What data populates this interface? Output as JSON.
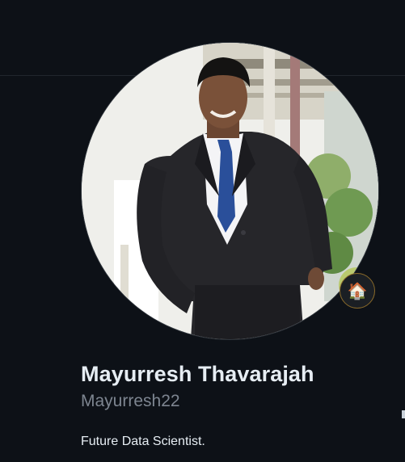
{
  "profile": {
    "full_name": "Mayurresh Thavarajah",
    "username": "Mayurresh22",
    "bio": "Future Data Scientist.",
    "status_icon": "house-emoji",
    "status_glyph": "🏠"
  },
  "colors": {
    "background": "#0d1117",
    "name_text": "#e6edf3",
    "username_text": "#7d8590",
    "status_ring": "#8a6a2a"
  }
}
